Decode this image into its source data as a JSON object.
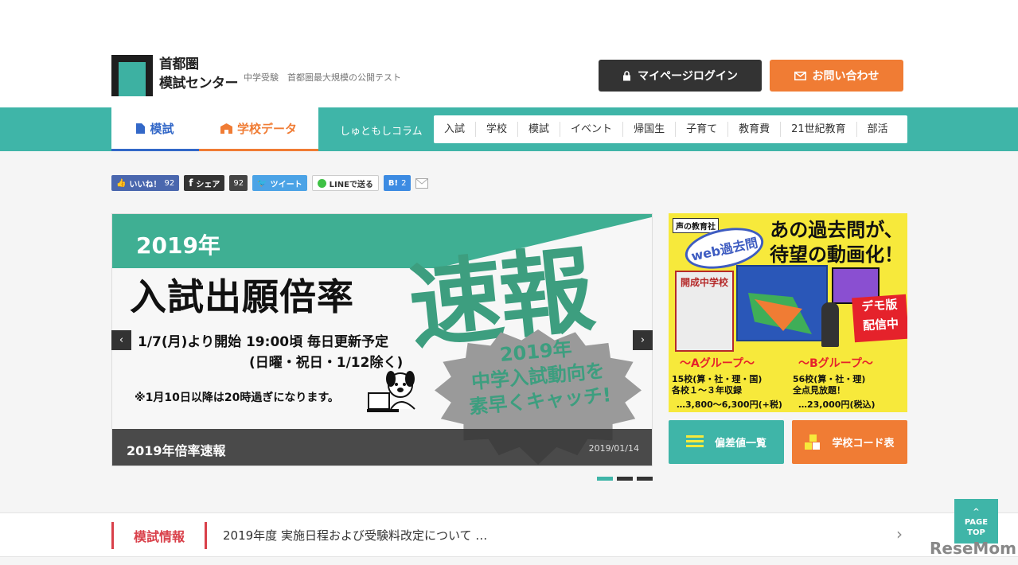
{
  "header": {
    "logo_line1": "首都圏",
    "logo_line2": "模試センター",
    "tagline": "中学受験　首都圏最大規模の公開テスト",
    "login_label": "マイページログイン",
    "contact_label": "お問い合わせ"
  },
  "nav": {
    "tabs": [
      {
        "label": "模試",
        "icon": "document-icon"
      },
      {
        "label": "学校データ",
        "icon": "school-icon"
      }
    ],
    "column_label": "しゅともしコラム",
    "categories": [
      "入試",
      "学校",
      "模試",
      "イベント",
      "帰国生",
      "子育て",
      "教育費",
      "21世紀教育",
      "部活"
    ]
  },
  "social": {
    "like_label": "いいね！",
    "like_count": "92",
    "share_label": "シェア",
    "share_count": "92",
    "tweet_label": "ツイート",
    "line_label": "LINEで送る",
    "hatena_label": "B!",
    "hatena_count": "2"
  },
  "hero": {
    "year": "2019年",
    "title": "入試出願倍率",
    "big_word": "速報",
    "line1": "1/7(月)より開始 19:00頃 毎日更新予定",
    "line2": "(日曜・祝日・1/12除く)",
    "note": "※1月10日以降は20時過ぎになります。",
    "burst_line1": "2019年",
    "burst_line2": "中学入試動向を",
    "burst_line3": "素早くキャッチ!",
    "caption_title": "2019年倍率速報",
    "caption_date": "2019/01/14",
    "slide_count": 3,
    "active_slide": 1
  },
  "ad": {
    "publisher": "声の教育社",
    "web_badge": "web過去問",
    "headline_line1": "あの過去問が、",
    "headline_line2": "待望の動画化！",
    "book_title": "開成中学校",
    "demo_line1": "デモ版",
    "demo_line2": "配信中",
    "group_a": "～Aグループ～",
    "group_b": "～Bグループ～",
    "group_a_line1": "15校(算・社・理・国)",
    "group_a_line2": "各校１～３年収録",
    "group_a_price": "…3,800～6,300円(+税)",
    "group_b_line1": "56校(算・社・理)",
    "group_b_line2": "全点見放題！",
    "group_b_price": "…23,000円(税込)"
  },
  "side_buttons": {
    "hensachi_label": "偏差値一覧",
    "schoolcode_label": "学校コード表"
  },
  "news": {
    "label": "模試情報",
    "text": "2019年度 実施日程および受験料改定について …"
  },
  "pagetop": {
    "line1": "PAGE",
    "line2": "TOP"
  },
  "watermark": "ReseMom",
  "colors": {
    "teal": "#3fb5a8",
    "orange": "#f07c34",
    "dark": "#333333",
    "red": "#d9404a",
    "blue": "#3368c8"
  }
}
